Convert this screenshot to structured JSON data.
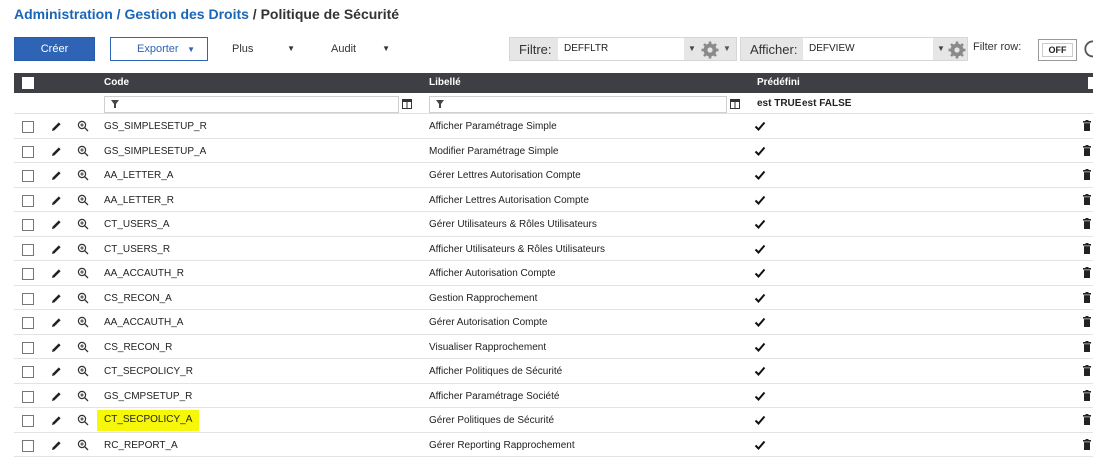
{
  "breadcrumb": {
    "part1": "Administration",
    "sep1": " / ",
    "part2": "Gestion des Droits",
    "sep2": " / ",
    "part3": "Politique de Sécurité"
  },
  "toolbar": {
    "create_label": "Créer",
    "export_label": "Exporter",
    "plus_label": "Plus",
    "audit_label": "Audit",
    "filter_label": "Filtre:",
    "filter_value": "DEFFLTR",
    "view_label": "Afficher:",
    "view_value": "DEFVIEW",
    "filter_row_label": "Filter row:",
    "filter_row_state": "OFF"
  },
  "grid": {
    "columns": {
      "code": "Code",
      "libelle": "Libellé",
      "predefini": "Prédéfini"
    },
    "filters": {
      "true_label": "est TRUE",
      "false_label": "est FALSE"
    },
    "rows": [
      {
        "code": "GS_SIMPLESETUP_R",
        "libelle": "Afficher Paramétrage Simple",
        "predefini": true
      },
      {
        "code": "GS_SIMPLESETUP_A",
        "libelle": "Modifier Paramétrage Simple",
        "predefini": true
      },
      {
        "code": "AA_LETTER_A",
        "libelle": "Gérer Lettres Autorisation Compte",
        "predefini": true
      },
      {
        "code": "AA_LETTER_R",
        "libelle": "Afficher Lettres Autorisation Compte",
        "predefini": true
      },
      {
        "code": "CT_USERS_A",
        "libelle": "Gérer Utilisateurs & Rôles Utilisateurs",
        "predefini": true
      },
      {
        "code": "CT_USERS_R",
        "libelle": "Afficher Utilisateurs & Rôles Utilisateurs",
        "predefini": true
      },
      {
        "code": "AA_ACCAUTH_R",
        "libelle": "Afficher Autorisation Compte",
        "predefini": true
      },
      {
        "code": "CS_RECON_A",
        "libelle": "Gestion Rapprochement",
        "predefini": true
      },
      {
        "code": "AA_ACCAUTH_A",
        "libelle": "Gérer Autorisation Compte",
        "predefini": true
      },
      {
        "code": "CS_RECON_R",
        "libelle": "Visualiser Rapprochement",
        "predefini": true
      },
      {
        "code": "CT_SECPOLICY_R",
        "libelle": "Afficher Politiques de Sécurité",
        "predefini": true
      },
      {
        "code": "GS_CMPSETUP_R",
        "libelle": "Afficher Paramétrage Société",
        "predefini": true
      },
      {
        "code": "CT_SECPOLICY_A",
        "libelle": "Gérer Politiques de Sécurité",
        "predefini": true,
        "highlighted": true
      },
      {
        "code": "RC_REPORT_A",
        "libelle": "Gérer Reporting Rapprochement",
        "predefini": true
      }
    ]
  },
  "colors": {
    "primary": "#2e63b5",
    "header_bg": "#3d3f45",
    "highlight": "#f7f70a"
  }
}
